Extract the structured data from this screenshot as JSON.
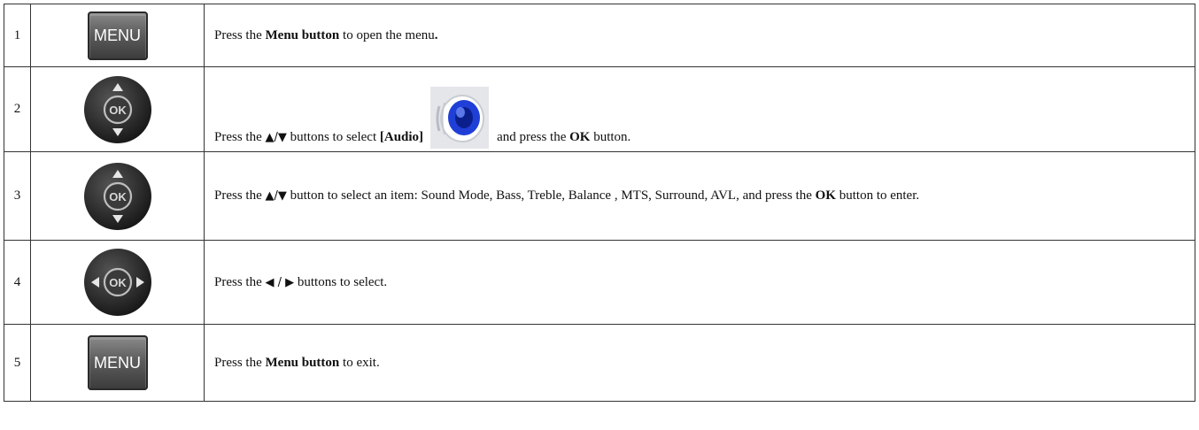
{
  "steps": [
    {
      "num": "1",
      "icon": "menu-button",
      "icon_label": "MENU",
      "text": {
        "pre": "Press the ",
        "bold1": "Menu button",
        "post": " to open the menu",
        "bold_end": "."
      }
    },
    {
      "num": "2",
      "icon": "dpad-up-down",
      "ok_label": "OK",
      "text": {
        "pre": "Press the ",
        "arrows": "▲/▼",
        "mid": " buttons to select ",
        "bold1": "[Audio]",
        "after_icon": " and press the ",
        "bold2": "OK",
        "post": " button."
      }
    },
    {
      "num": "3",
      "icon": "dpad-up-down",
      "ok_label": "OK",
      "text": {
        "pre": "Press the ",
        "arrows": "▲/▼",
        "mid": " button to select an item: Sound Mode, Bass, Treble, Balance , MTS, Surround, AVL, and press the ",
        "bold1": "OK",
        "post": " button to enter."
      }
    },
    {
      "num": "4",
      "icon": "dpad-left-right",
      "ok_label": "OK",
      "text": {
        "pre": "Press the ",
        "arrows": "◀ / ▶",
        "post": " buttons to select."
      }
    },
    {
      "num": "5",
      "icon": "menu-button",
      "icon_label": "MENU",
      "text": {
        "pre": "Press the ",
        "bold1": "Menu button",
        "post": " to exit."
      }
    }
  ],
  "colors": {
    "border": "#333333",
    "menu_button": "#5e5e5e",
    "dpad": "#2b2b2b",
    "speaker_accent": "#1f3fd6"
  }
}
